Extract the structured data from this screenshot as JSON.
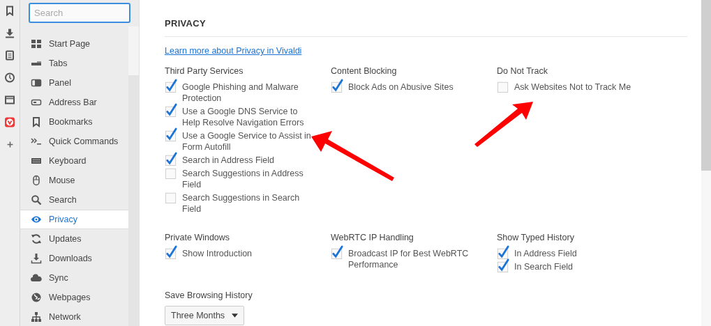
{
  "sidebar": {
    "search": {
      "placeholder": "Search"
    },
    "items": [
      {
        "label": "Start Page",
        "selected": false
      },
      {
        "label": "Tabs",
        "selected": false
      },
      {
        "label": "Panel",
        "selected": false
      },
      {
        "label": "Address Bar",
        "selected": false
      },
      {
        "label": "Bookmarks",
        "selected": false
      },
      {
        "label": "Quick Commands",
        "selected": false
      },
      {
        "label": "Keyboard",
        "selected": false
      },
      {
        "label": "Mouse",
        "selected": false
      },
      {
        "label": "Search",
        "selected": false
      },
      {
        "label": "Privacy",
        "selected": true
      },
      {
        "label": "Updates",
        "selected": false
      },
      {
        "label": "Downloads",
        "selected": false
      },
      {
        "label": "Sync",
        "selected": false
      },
      {
        "label": "Webpages",
        "selected": false
      },
      {
        "label": "Network",
        "selected": false
      }
    ]
  },
  "page": {
    "title": "PRIVACY",
    "link": "Learn more about Privacy in Vivaldi",
    "groups": [
      {
        "kind": "checkboxes",
        "heading": "Third Party Services",
        "options": [
          {
            "label": "Google Phishing and Malware Protection",
            "checked": true
          },
          {
            "label": "Use a Google DNS Service to Help Resolve Navigation Errors",
            "checked": true
          },
          {
            "label": "Use a Google Service to Assist in Form Autofill",
            "checked": true
          },
          {
            "label": "Search in Address Field",
            "checked": true
          },
          {
            "label": "Search Suggestions in Address Field",
            "checked": false
          },
          {
            "label": "Search Suggestions in Search Field",
            "checked": false
          }
        ]
      },
      {
        "kind": "checkboxes",
        "heading": "Content Blocking",
        "options": [
          {
            "label": "Block Ads on Abusive Sites",
            "checked": true
          }
        ]
      },
      {
        "kind": "checkboxes",
        "heading": "Do Not Track",
        "options": [
          {
            "label": "Ask Websites Not to Track Me",
            "checked": false
          }
        ]
      },
      {
        "kind": "checkboxes",
        "heading": "Private Windows",
        "options": [
          {
            "label": "Show Introduction",
            "checked": true
          }
        ]
      },
      {
        "kind": "checkboxes",
        "heading": "WebRTC IP Handling",
        "options": [
          {
            "label": "Broadcast IP for Best WebRTC Performance",
            "checked": true
          }
        ]
      },
      {
        "kind": "checkboxes",
        "heading": "Show Typed History",
        "options": [
          {
            "label": "In Address Field",
            "checked": true
          },
          {
            "label": "In Search Field",
            "checked": true
          }
        ]
      },
      {
        "kind": "select",
        "heading": "Save Browsing History",
        "value": "Three Months"
      }
    ]
  }
}
